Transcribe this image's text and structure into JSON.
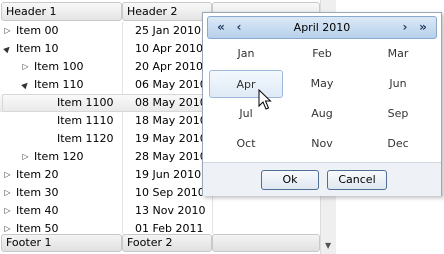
{
  "grid": {
    "headers": [
      "Header 1",
      "Header 2",
      ""
    ],
    "footers": [
      "Footer 1",
      "Footer 2",
      ""
    ],
    "rows": [
      {
        "name": "Item 00",
        "date": "25 Jan 2010",
        "level": 0,
        "expander": "collapsed",
        "selected": false
      },
      {
        "name": "Item 10",
        "date": "10 Apr 2010",
        "level": 0,
        "expander": "expanded",
        "selected": false
      },
      {
        "name": "Item 100",
        "date": "20 Apr 2010",
        "level": 1,
        "expander": "collapsed",
        "selected": false
      },
      {
        "name": "Item 110",
        "date": "06 May 2010",
        "level": 1,
        "expander": "expanded",
        "selected": false
      },
      {
        "name": "Item 1100",
        "date": "08 May 2010",
        "level": 2,
        "expander": "none",
        "selected": true
      },
      {
        "name": "Item 1110",
        "date": "18 May 2010",
        "level": 2,
        "expander": "none",
        "selected": false
      },
      {
        "name": "Item 1120",
        "date": "19 May 2010",
        "level": 2,
        "expander": "none",
        "selected": false
      },
      {
        "name": "Item 120",
        "date": "28 May 2010",
        "level": 1,
        "expander": "collapsed",
        "selected": false
      },
      {
        "name": "Item 20",
        "date": "19 Jun 2010",
        "level": 0,
        "expander": "collapsed",
        "selected": false
      },
      {
        "name": "Item 30",
        "date": "10 Sep 2010",
        "level": 0,
        "expander": "collapsed",
        "selected": false
      },
      {
        "name": "Item 40",
        "date": "13 Nov 2010",
        "level": 0,
        "expander": "collapsed",
        "selected": false
      },
      {
        "name": "Item 50",
        "date": "01 Feb 2011",
        "level": 0,
        "expander": "collapsed",
        "selected": false
      }
    ],
    "icons": {
      "expanded": "▲",
      "collapsed": "▷",
      "scroll_down": "▼"
    }
  },
  "calendar": {
    "title": "April 2010",
    "nav": {
      "prev_year": "«",
      "prev": "‹",
      "next": "›",
      "next_year": "»"
    },
    "months": [
      "Jan",
      "Feb",
      "Mar",
      "Apr",
      "May",
      "Jun",
      "Jul",
      "Aug",
      "Sep",
      "Oct",
      "Nov",
      "Dec"
    ],
    "hovered_month": "Apr",
    "ok_label": "Ok",
    "cancel_label": "Cancel"
  },
  "colors": {
    "header_accent": "#b7d0ea",
    "button_border": "#4f6f99"
  }
}
